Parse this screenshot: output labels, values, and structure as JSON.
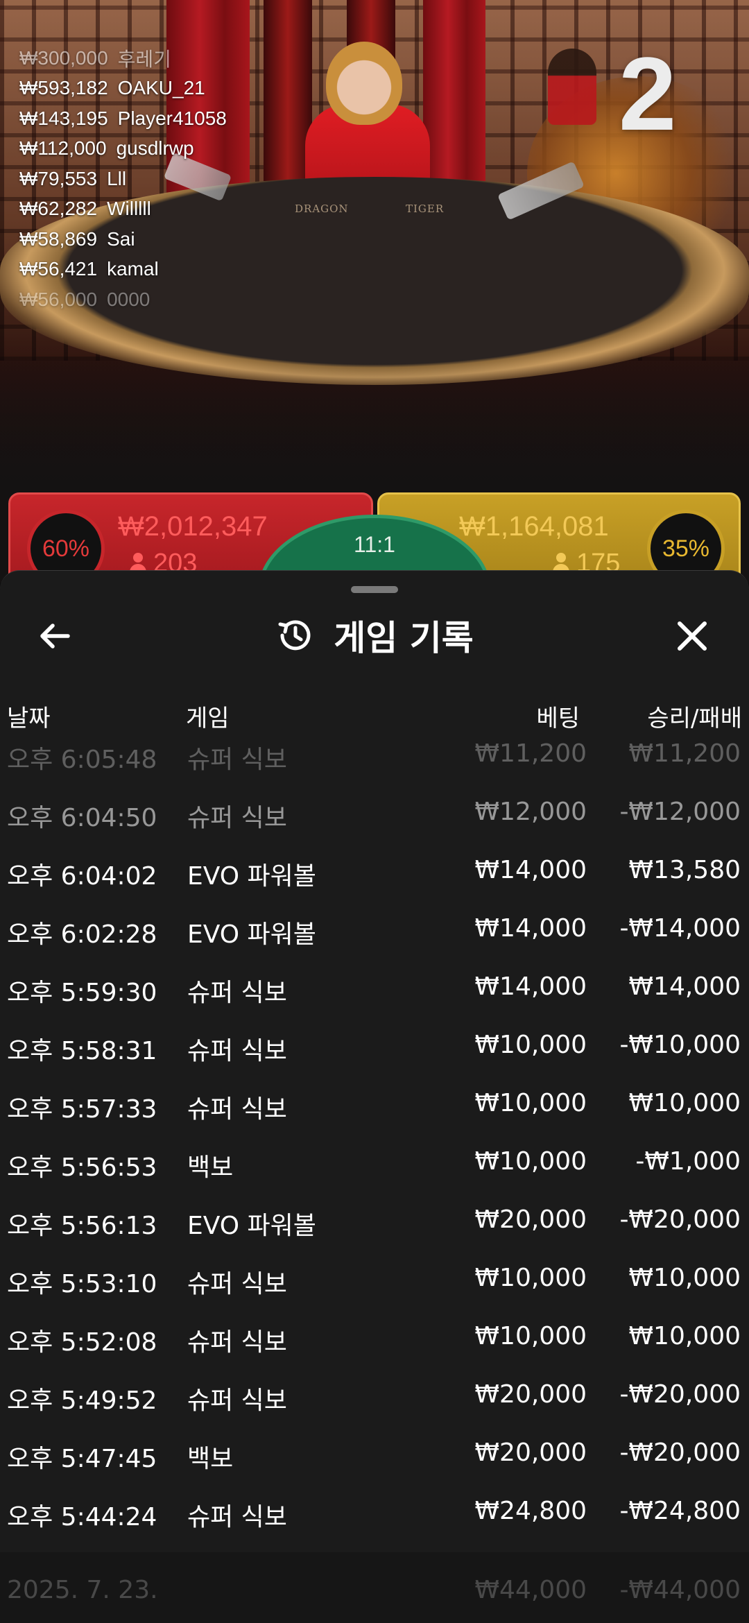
{
  "leaderboard": [
    {
      "amount": "₩300,000",
      "name": "후레기"
    },
    {
      "amount": "₩593,182",
      "name": "OAKU_21"
    },
    {
      "amount": "₩143,195",
      "name": "Player41058"
    },
    {
      "amount": "₩112,000",
      "name": "gusdlrwp"
    },
    {
      "amount": "₩79,553",
      "name": "Lll"
    },
    {
      "amount": "₩62,282",
      "name": "Willlll"
    },
    {
      "amount": "₩58,869",
      "name": "Sai"
    },
    {
      "amount": "₩56,421",
      "name": "kamal"
    },
    {
      "amount": "₩56,000",
      "name": "0000"
    }
  ],
  "round_number": "2",
  "table": {
    "dragon_label": "DRAGON",
    "tiger_label": "TIGER"
  },
  "betting": {
    "dragon": {
      "percent": "60%",
      "amount": "₩2,012,347",
      "players": "203",
      "color": "#c7262b"
    },
    "tiger": {
      "percent": "35%",
      "amount": "₩1,164,081",
      "players": "175",
      "color": "#c8a026"
    },
    "tie": {
      "ratio": "11:1",
      "color": "#16724a"
    }
  },
  "history_panel": {
    "title": "게임 기록",
    "columns": {
      "date": "날짜",
      "game": "게임",
      "bet": "베팅",
      "result": "승리/패배"
    },
    "rows": [
      {
        "date": "오후 6:05:48",
        "game": "슈퍼 식보",
        "bet": "₩11,200",
        "result": "₩11,200"
      },
      {
        "date": "오후 6:04:50",
        "game": "슈퍼 식보",
        "bet": "₩12,000",
        "result": "-₩12,000"
      },
      {
        "date": "오후 6:04:02",
        "game": "EVO 파워볼",
        "bet": "₩14,000",
        "result": "₩13,580"
      },
      {
        "date": "오후 6:02:28",
        "game": "EVO 파워볼",
        "bet": "₩14,000",
        "result": "-₩14,000"
      },
      {
        "date": "오후 5:59:30",
        "game": "슈퍼 식보",
        "bet": "₩14,000",
        "result": "₩14,000"
      },
      {
        "date": "오후 5:58:31",
        "game": "슈퍼 식보",
        "bet": "₩10,000",
        "result": "-₩10,000"
      },
      {
        "date": "오후 5:57:33",
        "game": "슈퍼 식보",
        "bet": "₩10,000",
        "result": "₩10,000"
      },
      {
        "date": "오후 5:56:53",
        "game": "백보",
        "bet": "₩10,000",
        "result": "-₩1,000"
      },
      {
        "date": "오후 5:56:13",
        "game": "EVO 파워볼",
        "bet": "₩20,000",
        "result": "-₩20,000"
      },
      {
        "date": "오후 5:53:10",
        "game": "슈퍼 식보",
        "bet": "₩10,000",
        "result": "₩10,000"
      },
      {
        "date": "오후 5:52:08",
        "game": "슈퍼 식보",
        "bet": "₩10,000",
        "result": "₩10,000"
      },
      {
        "date": "오후 5:49:52",
        "game": "슈퍼 식보",
        "bet": "₩20,000",
        "result": "-₩20,000"
      },
      {
        "date": "오후 5:47:45",
        "game": "백보",
        "bet": "₩20,000",
        "result": "-₩20,000"
      },
      {
        "date": "오후 5:44:24",
        "game": "슈퍼 식보",
        "bet": "₩24,800",
        "result": "-₩24,800"
      }
    ],
    "next_group": {
      "date": "2025. 7. 23.",
      "bet": "₩44,000",
      "result": "-₩44,000"
    }
  },
  "icons": {
    "back": "arrow-left-icon",
    "history": "history-clock-icon",
    "close": "close-icon",
    "players": "person-icon"
  }
}
